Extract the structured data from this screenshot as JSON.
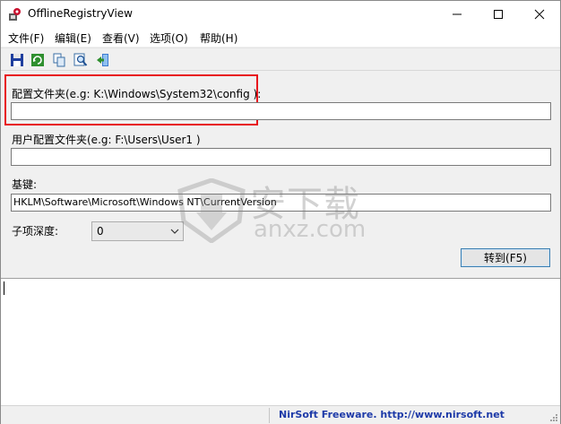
{
  "window": {
    "title": "OfflineRegistryView",
    "minimize_glyph": "─",
    "maximize_glyph": "☐",
    "close_glyph": "✕"
  },
  "menu": {
    "items": [
      {
        "label": "文件(F)"
      },
      {
        "label": "编辑(E)"
      },
      {
        "label": "查看(V)"
      },
      {
        "label": "选项(O)"
      },
      {
        "label": "帮助(H)"
      }
    ]
  },
  "toolbar": {
    "icons": [
      "save-icon",
      "refresh-icon",
      "copy-icon",
      "find-icon",
      "exit-icon"
    ]
  },
  "form": {
    "config_folder_label": "配置文件夹(e.g: K:\\Windows\\System32\\config ):",
    "config_folder_value": "",
    "user_config_label": "用户配置文件夹(e.g: F:\\Users\\User1 )",
    "user_config_value": "",
    "base_key_label": "基键:",
    "base_key_value": "HKLM\\Software\\Microsoft\\Windows NT\\CurrentVersion",
    "depth_label": "子项深度:",
    "depth_value": "0",
    "goto_button": "转到(F5)"
  },
  "watermark": {
    "title": "安下载",
    "url": "anxz.com"
  },
  "statusbar": {
    "text": "NirSoft Freeware.  http://www.nirsoft.net"
  },
  "colors": {
    "highlight_border": "#e8141c",
    "status_text": "#1d3aa8",
    "button_border": "#3c7fb1"
  }
}
